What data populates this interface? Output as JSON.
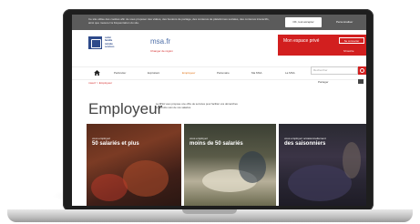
{
  "cookie_banner": {
    "text": "Ce site utilise des cookies afin de vous proposer des vidéos, des boutons de partage, des contenus de plateformes sociales, des contenus interactifs, ainsi que mesurer la fréquentation du site.",
    "accept_label": "OK, tout accepter",
    "info_label": "Personnaliser"
  },
  "header": {
    "logo_text": "santé\nfamille\nretraite\nservices",
    "site_name": "msa.fr",
    "region_link": "Changer de région",
    "espace_title": "Mon espace privé",
    "login_label": "Se connecter",
    "signup_label": "S'inscrire"
  },
  "nav": {
    "items": [
      "Particulier",
      "Exploitant",
      "Employeur",
      "Partenaire",
      "Ma MSA",
      "La MSA"
    ],
    "active": "Employeur",
    "search_placeholder": "Rechercher"
  },
  "breadcrumb": "msa.fr > Employeur",
  "tools": "Partager",
  "page": {
    "title": "Employeur",
    "intro": "La MSA vous propose une offre de services pour faciliter vos démarches et prendre soin de vos salariés."
  },
  "cards": [
    {
      "kicker": "vous employez",
      "title": "50 salariés et plus"
    },
    {
      "kicker": "vous employez",
      "title": "moins de 50 salariés"
    },
    {
      "kicker": "vous employez occasionnellement",
      "title": "des saisonniers"
    }
  ],
  "colors": {
    "accent_red": "#d21f1f",
    "brand_blue": "#2d4a8a",
    "active_orange": "#e07010"
  }
}
